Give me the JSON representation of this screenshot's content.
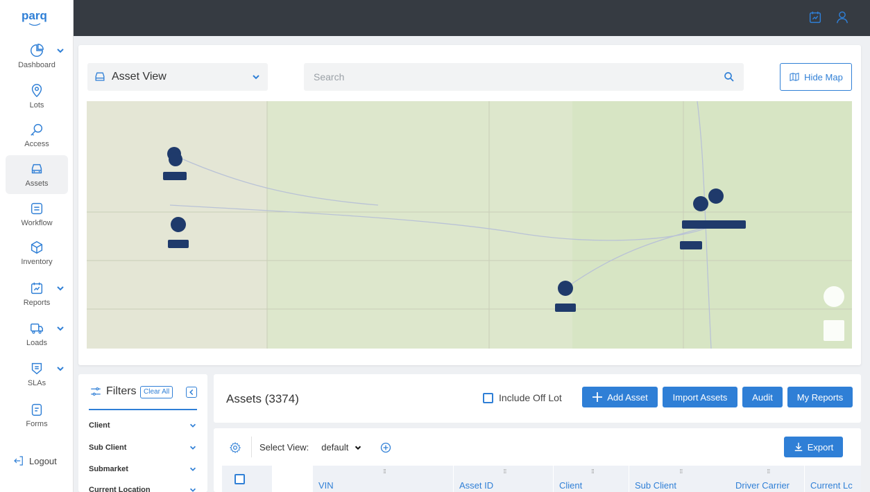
{
  "nav": {
    "items": [
      {
        "label": "Dashboard",
        "icon": "pie-chart-icon"
      },
      {
        "label": "Lots",
        "icon": "map-pin-icon"
      },
      {
        "label": "Access",
        "icon": "key-icon"
      },
      {
        "label": "Assets",
        "icon": "car-icon"
      },
      {
        "label": "Workflow",
        "icon": "workflow-icon"
      },
      {
        "label": "Inventory",
        "icon": "box-icon"
      },
      {
        "label": "Reports",
        "icon": "report-icon"
      },
      {
        "label": "Loads",
        "icon": "truck-icon"
      },
      {
        "label": "SLAs",
        "icon": "shield-icon"
      },
      {
        "label": "Forms",
        "icon": "form-icon"
      }
    ],
    "logout": "Logout"
  },
  "toolbar": {
    "asset_view_label": "Asset View",
    "search_placeholder": "Search",
    "hide_map_label": "Hide Map"
  },
  "filters": {
    "title": "Filters",
    "clear_all": "Clear All",
    "items": [
      "Client",
      "Sub Client",
      "Submarket",
      "Current Location"
    ]
  },
  "assets": {
    "title": "Assets (3374)",
    "include_off_lot": "Include Off Lot",
    "add_asset": "Add Asset",
    "import_assets": "Import Assets",
    "audit": "Audit",
    "my_reports": "My Reports"
  },
  "table": {
    "select_view_label": "Select View:",
    "select_view_value": "default",
    "export_label": "Export",
    "columns": [
      "VIN",
      "Asset ID",
      "Client",
      "Sub Client",
      "Driver Carrier",
      "Current Lc"
    ]
  },
  "colors": {
    "accent": "#2f7fd6",
    "topbar": "#363b42",
    "marker": "#1f3a6b"
  }
}
